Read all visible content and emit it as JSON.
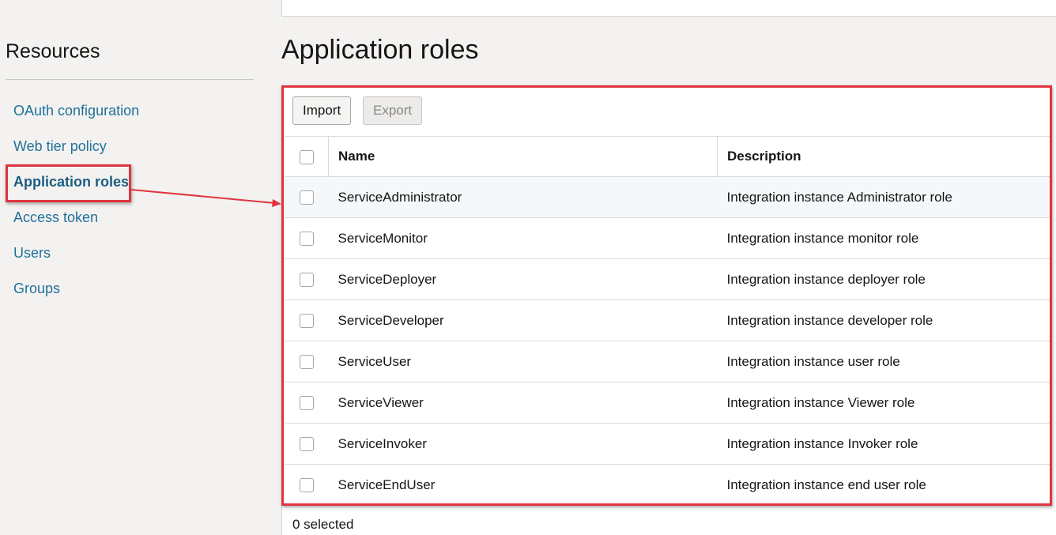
{
  "sidebar": {
    "title": "Resources",
    "items": [
      {
        "label": "OAuth configuration"
      },
      {
        "label": "Web tier policy"
      },
      {
        "label": "Application roles"
      },
      {
        "label": "Access token"
      },
      {
        "label": "Users"
      },
      {
        "label": "Groups"
      }
    ]
  },
  "main": {
    "title": "Application roles",
    "toolbar": {
      "import_label": "Import",
      "export_label": "Export"
    },
    "table": {
      "columns": [
        "Name",
        "Description"
      ],
      "rows": [
        {
          "name": "ServiceAdministrator",
          "description": "Integration instance Administrator role"
        },
        {
          "name": "ServiceMonitor",
          "description": "Integration instance monitor role"
        },
        {
          "name": "ServiceDeployer",
          "description": "Integration instance deployer role"
        },
        {
          "name": "ServiceDeveloper",
          "description": "Integration instance developer role"
        },
        {
          "name": "ServiceUser",
          "description": "Integration instance user role"
        },
        {
          "name": "ServiceViewer",
          "description": "Integration instance Viewer role"
        },
        {
          "name": "ServiceInvoker",
          "description": "Integration instance Invoker role"
        },
        {
          "name": "ServiceEndUser",
          "description": "Integration instance end user role"
        }
      ]
    },
    "status": "0 selected"
  },
  "colors": {
    "link": "#227199",
    "annotation": "#e0333f",
    "background": "#f3f2f1"
  }
}
